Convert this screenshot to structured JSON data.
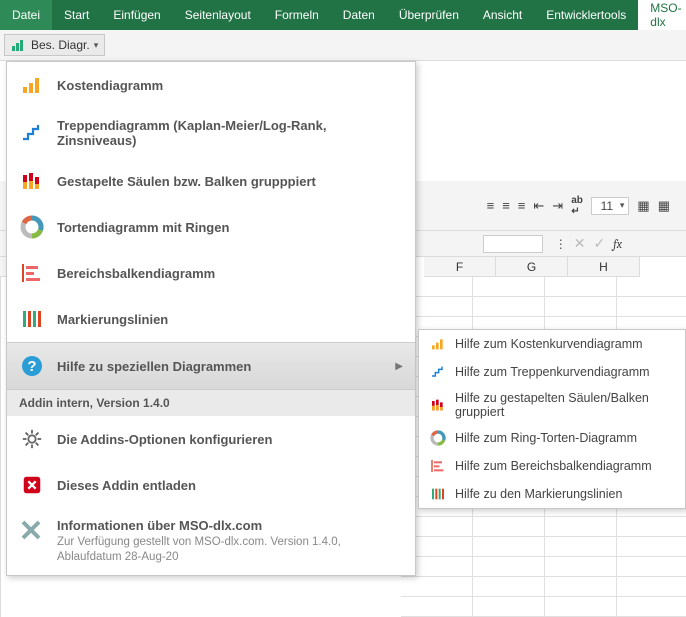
{
  "ribbon": {
    "tabs": [
      "Datei",
      "Start",
      "Einfügen",
      "Seitenlayout",
      "Formeln",
      "Daten",
      "Überprüfen",
      "Ansicht",
      "Entwicklertools",
      "MSO-dlx"
    ],
    "active_index": 9
  },
  "toolbar": {
    "button_label": "Bes. Diagr.",
    "font_size": "11"
  },
  "menu": {
    "items": [
      {
        "label": "Kostendiagramm",
        "icon": "bars-asc"
      },
      {
        "label": "Treppendiagramm (Kaplan-Meier/Log-Rank, Zinsniveaus)",
        "icon": "steps"
      },
      {
        "label": "Gestapelte Säulen bzw. Balken grupppiert",
        "icon": "stacked-bars"
      },
      {
        "label": "Tortendiagramm mit Ringen",
        "icon": "donut"
      },
      {
        "label": "Bereichsbalkendiagramm",
        "icon": "range-bars"
      },
      {
        "label": "Markierungslinien",
        "icon": "marker-lines"
      }
    ],
    "help": {
      "label": "Hilfe zu speziellen Diagrammen",
      "icon": "help"
    },
    "section_label": "Addin intern, Version 1.4.0",
    "config": {
      "label": "Die Addins-Optionen konfigurieren",
      "icon": "gear"
    },
    "unload": {
      "label": "Dieses Addin entladen",
      "icon": "close-red"
    },
    "info": {
      "title": "Informationen über MSO-dlx.com",
      "sub": "Zur Verfügung gestellt von MSO-dlx.com. Version 1.4.0, Ablaufdatum 28-Aug-20",
      "icon": "xlogo"
    }
  },
  "submenu": {
    "items": [
      {
        "label": "Hilfe zum Kostenkurvendiagramm",
        "icon": "bars-asc"
      },
      {
        "label": "Hilfe zum Treppenkurvendiagramm",
        "icon": "steps"
      },
      {
        "label": "Hilfe zu gestapelten Säulen/Balken gruppiert",
        "icon": "stacked-bars"
      },
      {
        "label": "Hilfe zum Ring-Torten-Diagramm",
        "icon": "donut"
      },
      {
        "label": "Hilfe zum Bereichsbalkendiagramm",
        "icon": "range-bars"
      },
      {
        "label": "Hilfe zu den Markierungslinien",
        "icon": "marker-lines"
      }
    ]
  },
  "columns": [
    "F",
    "G",
    "H"
  ],
  "formulabar": {
    "fx": "fx"
  }
}
